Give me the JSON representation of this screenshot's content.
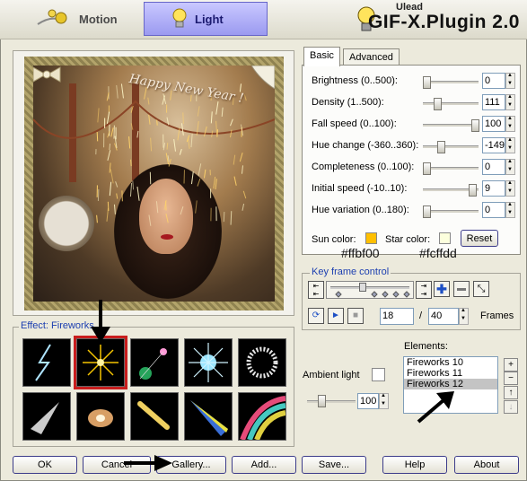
{
  "header": {
    "tabs": [
      {
        "label": "Motion"
      },
      {
        "label": "Light"
      }
    ],
    "brand_top": "Ulead",
    "brand_title": "GIF-X.Plugin 2.0"
  },
  "preview": {
    "overlay_text": "Happy New Year !"
  },
  "effect": {
    "title": "Effect: Fireworks",
    "thumbnails": [
      "lightning",
      "fireworks",
      "lens-flare",
      "star-burst",
      "ring",
      "spotlight",
      "glow",
      "comet",
      "beam",
      "rainbow"
    ],
    "selected_index": 1
  },
  "tabs": [
    {
      "label": "Basic"
    },
    {
      "label": "Advanced"
    }
  ],
  "params": [
    {
      "label": "Brightness (0..500):",
      "value": "0",
      "level": 0.0
    },
    {
      "label": "Density (1..500):",
      "value": "111",
      "level": 0.22
    },
    {
      "label": "Fall speed (0..100):",
      "value": "100",
      "level": 1.0
    },
    {
      "label": "Hue change (-360..360):",
      "value": "-149",
      "level": 0.29
    },
    {
      "label": "Completeness (0..100):",
      "value": "0",
      "level": 0.0
    },
    {
      "label": "Initial speed (-10..10):",
      "value": "9",
      "level": 0.95
    },
    {
      "label": "Hue variation (0..180):",
      "value": "0",
      "level": 0.0
    }
  ],
  "colors": {
    "sun_label": "Sun color:",
    "star_label": "Star color:",
    "reset_label": "Reset",
    "sun_hex": "#ffbf00",
    "star_hex": "#fcffdd"
  },
  "keyframe": {
    "title": "Key frame control",
    "frame_value": "18",
    "slash": "/",
    "total_frames": "40",
    "frames_label": "Frames"
  },
  "ambient": {
    "label": "Ambient light",
    "value": "100",
    "level": 0.25
  },
  "elements": {
    "label": "Elements:",
    "items": [
      "Fireworks 10",
      "Fireworks 11",
      "Fireworks 12"
    ],
    "selected_index": 2
  },
  "buttons": {
    "ok": "OK",
    "cancel": "Cancel",
    "gallery": "Gallery...",
    "add": "Add...",
    "save": "Save...",
    "help": "Help",
    "about": "About"
  }
}
